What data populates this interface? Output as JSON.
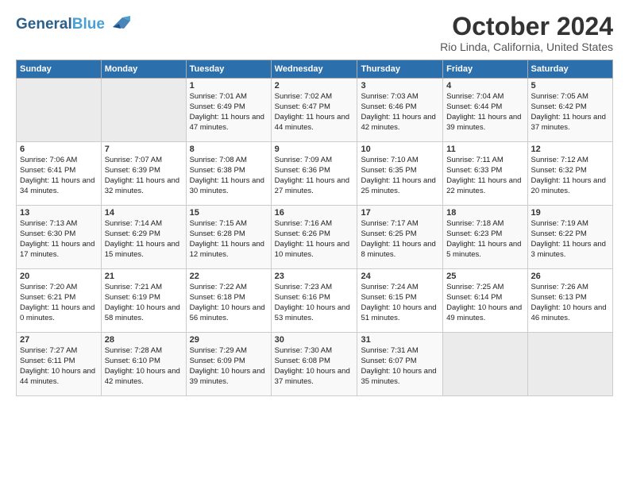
{
  "header": {
    "logo_line1": "General",
    "logo_line2": "Blue",
    "month": "October 2024",
    "location": "Rio Linda, California, United States"
  },
  "weekdays": [
    "Sunday",
    "Monday",
    "Tuesday",
    "Wednesday",
    "Thursday",
    "Friday",
    "Saturday"
  ],
  "weeks": [
    [
      {
        "day": "",
        "info": ""
      },
      {
        "day": "",
        "info": ""
      },
      {
        "day": "1",
        "info": "Sunrise: 7:01 AM\nSunset: 6:49 PM\nDaylight: 11 hours and 47 minutes."
      },
      {
        "day": "2",
        "info": "Sunrise: 7:02 AM\nSunset: 6:47 PM\nDaylight: 11 hours and 44 minutes."
      },
      {
        "day": "3",
        "info": "Sunrise: 7:03 AM\nSunset: 6:46 PM\nDaylight: 11 hours and 42 minutes."
      },
      {
        "day": "4",
        "info": "Sunrise: 7:04 AM\nSunset: 6:44 PM\nDaylight: 11 hours and 39 minutes."
      },
      {
        "day": "5",
        "info": "Sunrise: 7:05 AM\nSunset: 6:42 PM\nDaylight: 11 hours and 37 minutes."
      }
    ],
    [
      {
        "day": "6",
        "info": "Sunrise: 7:06 AM\nSunset: 6:41 PM\nDaylight: 11 hours and 34 minutes."
      },
      {
        "day": "7",
        "info": "Sunrise: 7:07 AM\nSunset: 6:39 PM\nDaylight: 11 hours and 32 minutes."
      },
      {
        "day": "8",
        "info": "Sunrise: 7:08 AM\nSunset: 6:38 PM\nDaylight: 11 hours and 30 minutes."
      },
      {
        "day": "9",
        "info": "Sunrise: 7:09 AM\nSunset: 6:36 PM\nDaylight: 11 hours and 27 minutes."
      },
      {
        "day": "10",
        "info": "Sunrise: 7:10 AM\nSunset: 6:35 PM\nDaylight: 11 hours and 25 minutes."
      },
      {
        "day": "11",
        "info": "Sunrise: 7:11 AM\nSunset: 6:33 PM\nDaylight: 11 hours and 22 minutes."
      },
      {
        "day": "12",
        "info": "Sunrise: 7:12 AM\nSunset: 6:32 PM\nDaylight: 11 hours and 20 minutes."
      }
    ],
    [
      {
        "day": "13",
        "info": "Sunrise: 7:13 AM\nSunset: 6:30 PM\nDaylight: 11 hours and 17 minutes."
      },
      {
        "day": "14",
        "info": "Sunrise: 7:14 AM\nSunset: 6:29 PM\nDaylight: 11 hours and 15 minutes."
      },
      {
        "day": "15",
        "info": "Sunrise: 7:15 AM\nSunset: 6:28 PM\nDaylight: 11 hours and 12 minutes."
      },
      {
        "day": "16",
        "info": "Sunrise: 7:16 AM\nSunset: 6:26 PM\nDaylight: 11 hours and 10 minutes."
      },
      {
        "day": "17",
        "info": "Sunrise: 7:17 AM\nSunset: 6:25 PM\nDaylight: 11 hours and 8 minutes."
      },
      {
        "day": "18",
        "info": "Sunrise: 7:18 AM\nSunset: 6:23 PM\nDaylight: 11 hours and 5 minutes."
      },
      {
        "day": "19",
        "info": "Sunrise: 7:19 AM\nSunset: 6:22 PM\nDaylight: 11 hours and 3 minutes."
      }
    ],
    [
      {
        "day": "20",
        "info": "Sunrise: 7:20 AM\nSunset: 6:21 PM\nDaylight: 11 hours and 0 minutes."
      },
      {
        "day": "21",
        "info": "Sunrise: 7:21 AM\nSunset: 6:19 PM\nDaylight: 10 hours and 58 minutes."
      },
      {
        "day": "22",
        "info": "Sunrise: 7:22 AM\nSunset: 6:18 PM\nDaylight: 10 hours and 56 minutes."
      },
      {
        "day": "23",
        "info": "Sunrise: 7:23 AM\nSunset: 6:16 PM\nDaylight: 10 hours and 53 minutes."
      },
      {
        "day": "24",
        "info": "Sunrise: 7:24 AM\nSunset: 6:15 PM\nDaylight: 10 hours and 51 minutes."
      },
      {
        "day": "25",
        "info": "Sunrise: 7:25 AM\nSunset: 6:14 PM\nDaylight: 10 hours and 49 minutes."
      },
      {
        "day": "26",
        "info": "Sunrise: 7:26 AM\nSunset: 6:13 PM\nDaylight: 10 hours and 46 minutes."
      }
    ],
    [
      {
        "day": "27",
        "info": "Sunrise: 7:27 AM\nSunset: 6:11 PM\nDaylight: 10 hours and 44 minutes."
      },
      {
        "day": "28",
        "info": "Sunrise: 7:28 AM\nSunset: 6:10 PM\nDaylight: 10 hours and 42 minutes."
      },
      {
        "day": "29",
        "info": "Sunrise: 7:29 AM\nSunset: 6:09 PM\nDaylight: 10 hours and 39 minutes."
      },
      {
        "day": "30",
        "info": "Sunrise: 7:30 AM\nSunset: 6:08 PM\nDaylight: 10 hours and 37 minutes."
      },
      {
        "day": "31",
        "info": "Sunrise: 7:31 AM\nSunset: 6:07 PM\nDaylight: 10 hours and 35 minutes."
      },
      {
        "day": "",
        "info": ""
      },
      {
        "day": "",
        "info": ""
      }
    ]
  ]
}
